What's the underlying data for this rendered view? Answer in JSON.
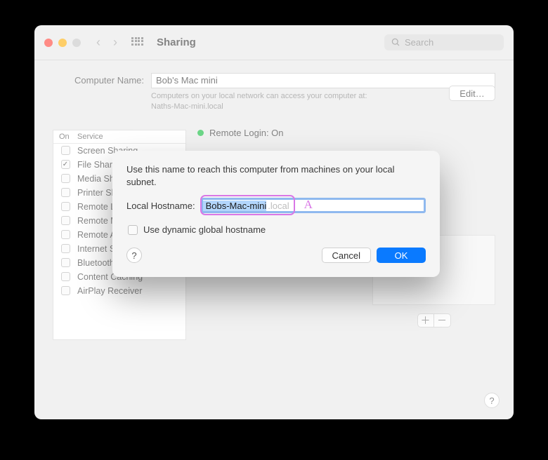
{
  "window": {
    "title": "Sharing",
    "search_placeholder": "Search"
  },
  "computer_name": {
    "label": "Computer Name:",
    "value": "Bob's Mac mini",
    "hint_line1": "Computers on your local network can access your computer at:",
    "hint_line2": "Naths-Mac-mini.local",
    "edit_button": "Edit…"
  },
  "services": {
    "col_on": "On",
    "col_service": "Service",
    "items": [
      {
        "checked": false,
        "name": "Screen Sharing"
      },
      {
        "checked": true,
        "name": "File Sharing"
      },
      {
        "checked": false,
        "name": "Media Sharing"
      },
      {
        "checked": false,
        "name": "Printer Sharing"
      },
      {
        "checked": false,
        "name": "Remote Login"
      },
      {
        "checked": false,
        "name": "Remote Management"
      },
      {
        "checked": false,
        "name": "Remote Apple Events"
      },
      {
        "checked": false,
        "name": "Internet Sharing"
      },
      {
        "checked": false,
        "name": "Bluetooth Sharing"
      },
      {
        "checked": false,
        "name": "Content Caching"
      },
      {
        "checked": false,
        "name": "AirPlay Receiver"
      }
    ]
  },
  "status": {
    "text": "Remote Login: On"
  },
  "dialog": {
    "message": "Use this name to reach this computer from machines on your local subnet.",
    "hostname_label": "Local Hostname:",
    "hostname_value": "Bobs-Mac-mini",
    "hostname_suffix": ".local",
    "dynamic_label": "Use dynamic global hostname",
    "cancel": "Cancel",
    "ok": "OK",
    "annotation": "A"
  },
  "help_glyph": "?"
}
